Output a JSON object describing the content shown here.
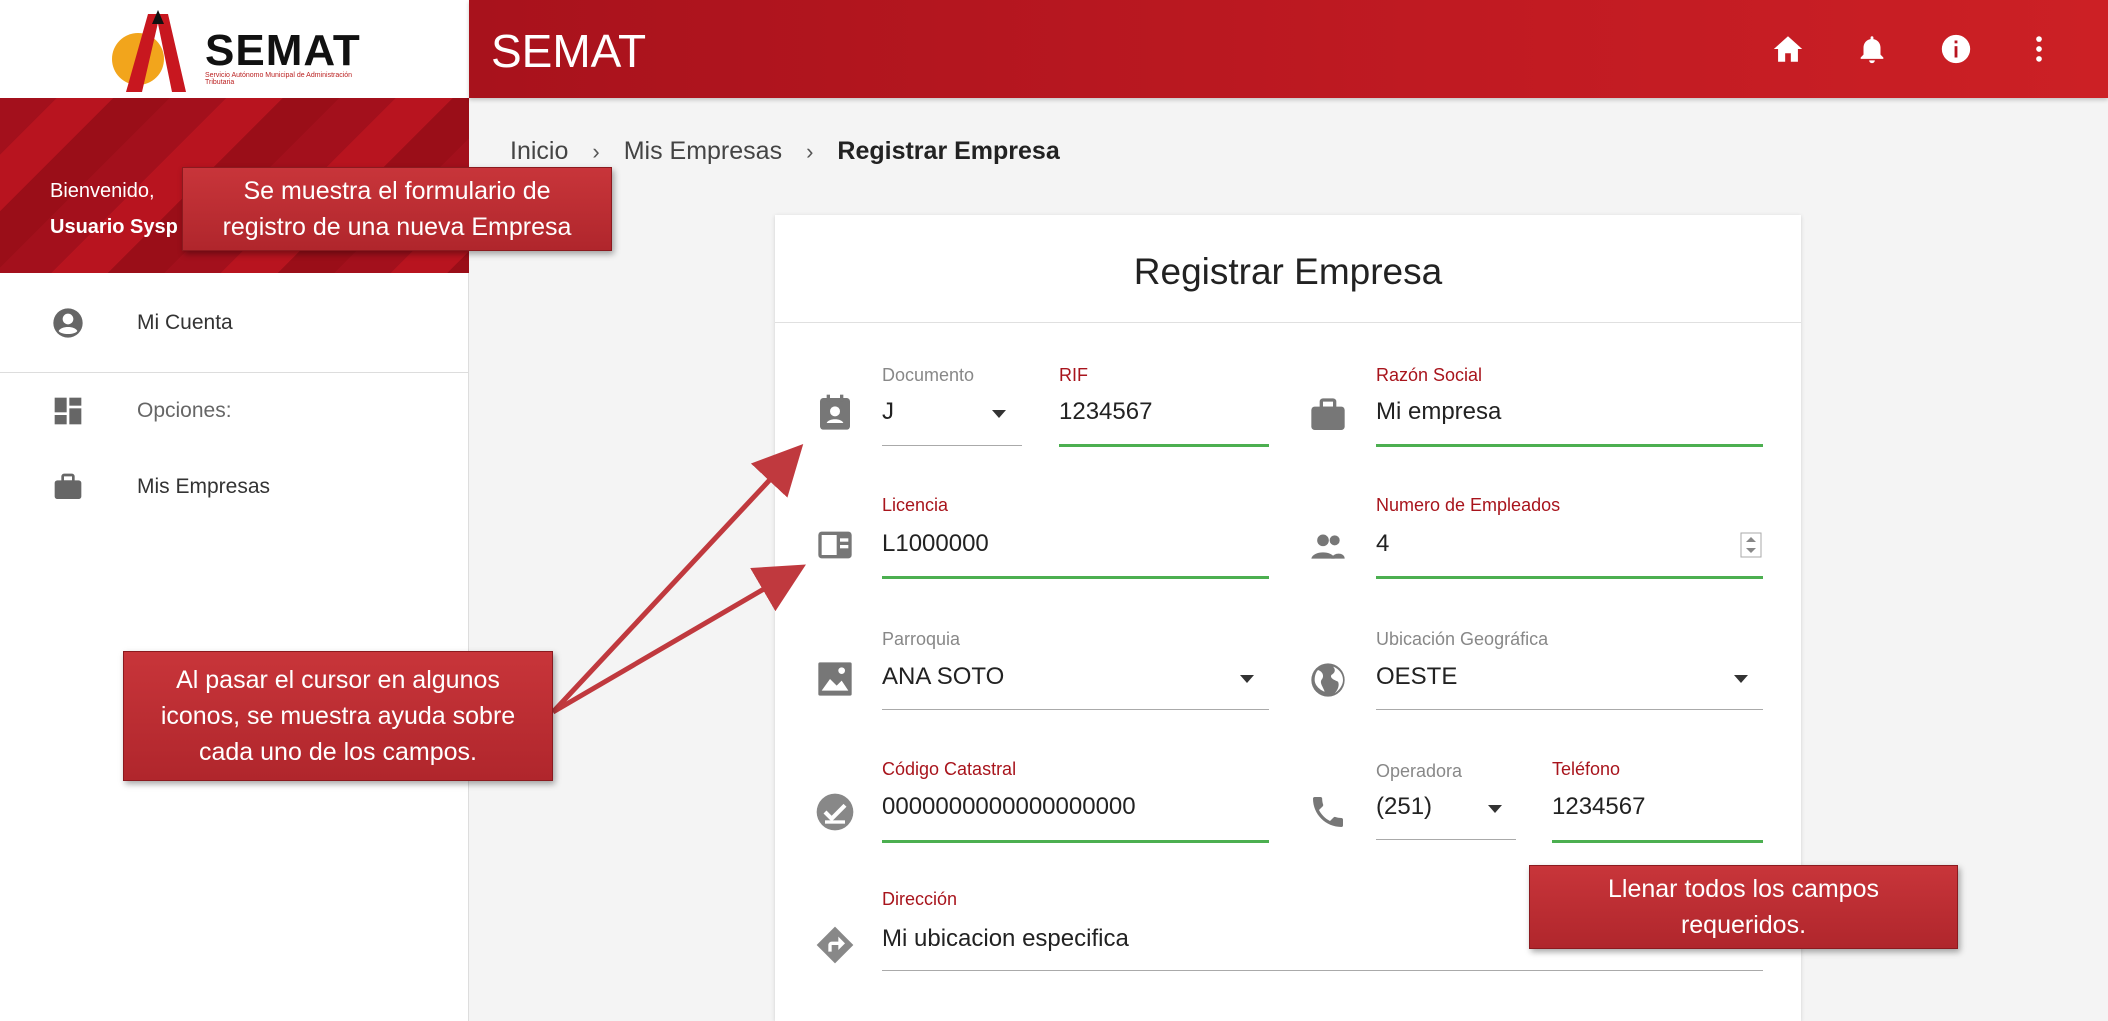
{
  "sidebar": {
    "logo_text": "SEMAT",
    "logo_sub": "Servicio Autónomo Municipal de Administración Tributaria",
    "welcome": "Bienvenido,",
    "username": "Usuario Sysp",
    "items": [
      {
        "label": "Mi Cuenta",
        "icon": "account-circle-icon"
      },
      {
        "label": "Opciones:",
        "icon": "dashboard-icon"
      },
      {
        "label": "Mis Empresas",
        "icon": "briefcase-icon"
      }
    ]
  },
  "topbar": {
    "title": "SEMAT",
    "icons": [
      "home-icon",
      "bell-icon",
      "info-icon",
      "more-vert-icon"
    ]
  },
  "breadcrumb": {
    "items": [
      "Inicio",
      "Mis Empresas",
      "Registrar Empresa"
    ]
  },
  "form": {
    "title": "Registrar Empresa",
    "documento": {
      "label": "Documento",
      "value": "J"
    },
    "rif": {
      "label": "RIF",
      "value": "1234567"
    },
    "razon_social": {
      "label": "Razón Social",
      "value": "Mi empresa"
    },
    "licencia": {
      "label": "Licencia",
      "value": "L1000000"
    },
    "empleados": {
      "label": "Numero de Empleados",
      "value": "4"
    },
    "parroquia": {
      "label": "Parroquia",
      "value": "ANA SOTO"
    },
    "ubicacion": {
      "label": "Ubicación Geográfica",
      "value": "OESTE"
    },
    "catastral": {
      "label": "Código Catastral",
      "value": "0000000000000000000"
    },
    "operadora": {
      "label": "Operadora",
      "value": "(251)"
    },
    "telefono": {
      "label": "Teléfono",
      "value": "1234567"
    },
    "direccion": {
      "label": "Dirección",
      "value": "Mi ubicacion especifica"
    }
  },
  "callouts": {
    "form_info": [
      "Se muestra el formulario de",
      "registro de una nueva Empresa"
    ],
    "hover_help": [
      "Al pasar el cursor en algunos",
      "iconos, se muestra ayuda sobre",
      "cada uno de los campos."
    ],
    "fill_required": [
      "Llenar todos los campos",
      "requeridos."
    ]
  },
  "colors": {
    "brand_red": "#b8141f",
    "valid_green": "#4caf50",
    "label_red": "#a8141c"
  }
}
